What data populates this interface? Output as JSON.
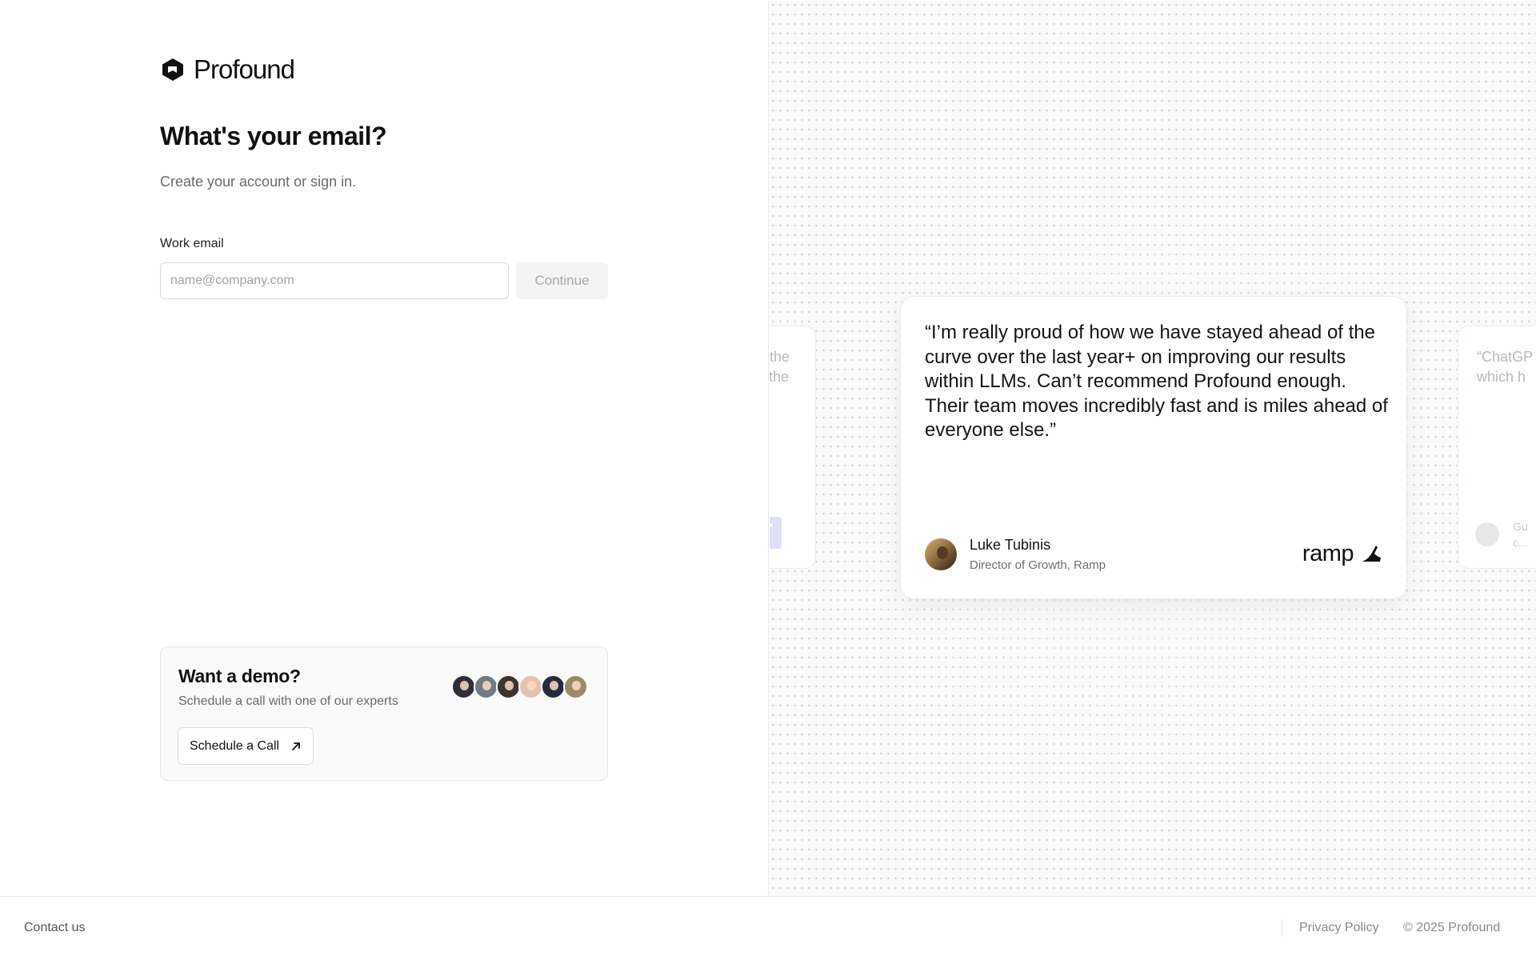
{
  "brand": {
    "name": "Profound"
  },
  "form": {
    "heading": "What's your email?",
    "subheading": "Create your account or sign in.",
    "email_label": "Work email",
    "email_value": "",
    "email_placeholder": "name@company.com",
    "continue_label": "Continue"
  },
  "demo": {
    "title": "Want a demo?",
    "subtitle": "Schedule a call with one of our experts",
    "button_label": "Schedule a Call",
    "button_icon": "arrow-up-right-icon",
    "avatar_colors": [
      "#2f2f3a",
      "#6f7c86",
      "#3b3530",
      "#e3c2b0",
      "#262b3d",
      "#9a8a6a"
    ]
  },
  "testimonials": {
    "left_partial_lines": "ded the\nook the\n\nhey",
    "left_partial_logo": "T",
    "main": {
      "quote": "“I’m really proud of how we have stayed ahead of the curve over the last year+ on improving our results within LLMs. Can’t recommend Profound enough. Their team moves incredibly fast and is miles ahead of everyone else.”",
      "name": "Luke Tubinis",
      "role": "Director of Growth, Ramp",
      "company_logo": "ramp"
    },
    "right_partial_lines": "“ChatGP\nwhich h",
    "right_partial_person": "Gu\nc..."
  },
  "footer": {
    "contact": "Contact us",
    "privacy": "Privacy Policy",
    "copyright": "© 2025 Profound"
  },
  "colors": {
    "text": "#111111",
    "muted": "#6b6b6b",
    "border": "#e6e6e6",
    "disabled_button_bg": "#f4f4f4",
    "panel_bg": "#fafafa"
  }
}
